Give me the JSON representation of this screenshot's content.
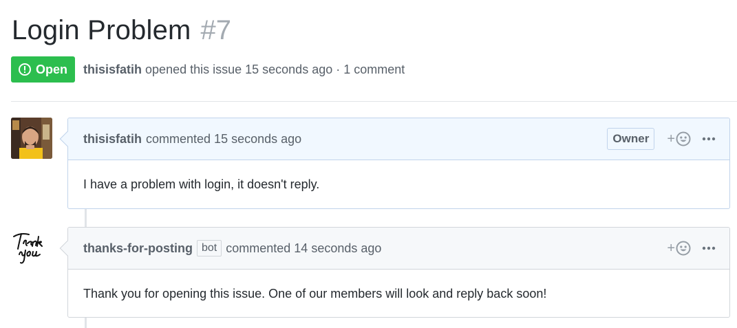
{
  "issue": {
    "title": "Login Problem",
    "number": "#7",
    "state": "Open",
    "author": "thisisfatih",
    "meta_text": "opened this issue 15 seconds ago · 1 comment"
  },
  "comments": [
    {
      "author": "thisisfatih",
      "action_text": "commented 15 seconds ago",
      "role_label": "Owner",
      "body": "I have a problem with login, it doesn't reply."
    },
    {
      "author": "thanks-for-posting",
      "bot_label": "bot",
      "action_text": "commented 14 seconds ago",
      "body": "Thank you for opening this issue. One of our members will look and reply back soon!"
    }
  ],
  "icons": {
    "state": "issue-opened-icon",
    "reaction": "smiley-icon",
    "more": "kebab-horizontal-icon"
  },
  "colors": {
    "open_green": "#2cbe4e",
    "owner_header_bg": "#f1f8ff",
    "bot_header_bg": "#f6f8fa"
  }
}
